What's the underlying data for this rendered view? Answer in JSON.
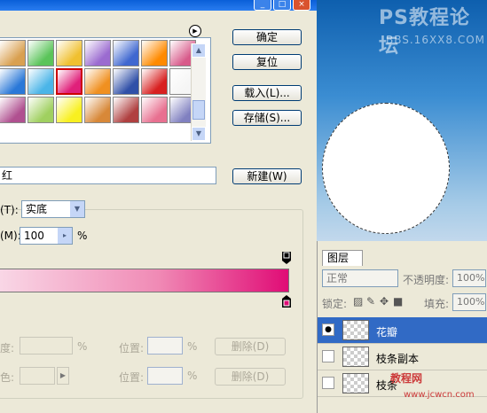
{
  "window": {
    "min_icon": "minimize-icon",
    "max_icon": "maximize-icon",
    "close_icon": "close-icon"
  },
  "buttons": {
    "ok": "确定",
    "reset": "复位",
    "load": "载入(L)...",
    "save": "存储(S)...",
    "new": "新建(W)"
  },
  "swatches": {
    "row1": [
      "#d9a050",
      "#5bc45a",
      "#f0c030",
      "#9b6bd0",
      "#4068d0",
      "#ff8a00",
      "#d85a8a"
    ],
    "row2": [
      "#2a78d8",
      "#4bb5e8",
      "#e0207a",
      "#f09020",
      "#3050a8",
      "#d82020",
      "#f5f5f5"
    ],
    "row3": [
      "#b05090",
      "#a0d060",
      "#f8f020",
      "#d88838",
      "#b04040",
      "#e87090",
      "#8080c0"
    ],
    "selected": "row2-2"
  },
  "name": {
    "value": "红"
  },
  "gradient_type": {
    "label": "(T):",
    "value": "实底"
  },
  "smoothness": {
    "label": "(M):",
    "value": "100",
    "unit": "%"
  },
  "color_stops": {
    "start_color": "#f9d7e6",
    "end_color": "#e00c76"
  },
  "stops_section": {
    "opacity_label": "度:",
    "opacity_unit": "%",
    "opacity_location_label": "位置:",
    "opacity_location_unit": "%",
    "delete1": "删除(D)",
    "color_label": "色:",
    "color_location_label": "位置:",
    "color_location_unit": "%",
    "delete2": "删除(D)"
  },
  "canvas": {
    "watermark_top": "PS教程论坛",
    "watermark_sub": "BBS.16XX8.COM"
  },
  "layers": {
    "tab": "图层",
    "tab_close": "×",
    "blend_mode": "正常",
    "opacity_label": "不透明度:",
    "opacity_value": "100%",
    "lock_label": "锁定:",
    "fill_label": "填充:",
    "fill_value": "100%",
    "items": [
      {
        "name": "花瓣",
        "visible": true,
        "active": true
      },
      {
        "name": "枝条副本",
        "visible": false,
        "active": false
      },
      {
        "name": "枝条",
        "visible": false,
        "active": false
      }
    ]
  },
  "site_watermark": {
    "line1": "教程网",
    "line2": "www.jcwcn.com"
  }
}
